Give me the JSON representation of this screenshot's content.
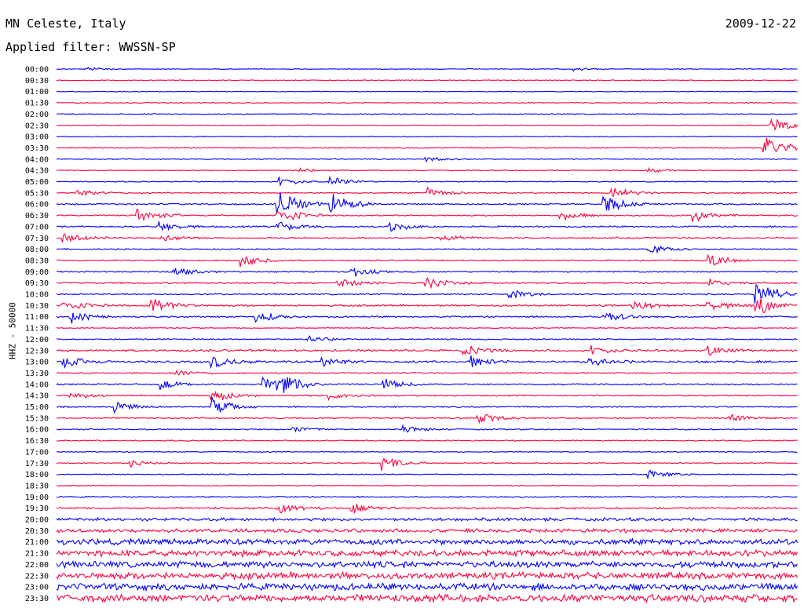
{
  "header": {
    "station": "MN Celeste, Italy",
    "date": "2009-12-22",
    "filter": "Applied filter: WWSSN-SP"
  },
  "chart_data": {
    "type": "line",
    "title": "MN Celeste, Italy",
    "date": "2009-12-22",
    "filter": "Applied filter: WWSSN-SP",
    "ylabel": "HHZ - 50000",
    "series_colors": [
      "#0000ff",
      "#ff0040"
    ],
    "rows": [
      {
        "label": "00:00",
        "amp": 0.12,
        "events": [
          {
            "x": 0.04,
            "h": 0.3
          },
          {
            "x": 0.7,
            "h": 0.3
          }
        ]
      },
      {
        "label": "00:30",
        "amp": 0.15,
        "events": []
      },
      {
        "label": "01:00",
        "amp": 0.12,
        "events": []
      },
      {
        "label": "01:30",
        "amp": 0.15,
        "events": []
      },
      {
        "label": "02:00",
        "amp": 0.15,
        "events": []
      },
      {
        "label": "02:30",
        "amp": 0.15,
        "events": [
          {
            "x": 0.965,
            "h": 1.5
          }
        ]
      },
      {
        "label": "03:00",
        "amp": 0.15,
        "events": []
      },
      {
        "label": "03:30",
        "amp": 0.18,
        "events": [
          {
            "x": 0.955,
            "h": 2.5
          }
        ]
      },
      {
        "label": "04:00",
        "amp": 0.15,
        "events": [
          {
            "x": 0.5,
            "h": 0.4
          }
        ]
      },
      {
        "label": "04:30",
        "amp": 0.15,
        "events": [
          {
            "x": 0.33,
            "h": 0.4
          },
          {
            "x": 0.8,
            "h": 0.3
          }
        ]
      },
      {
        "label": "05:00",
        "amp": 0.15,
        "events": [
          {
            "x": 0.3,
            "h": 0.8
          },
          {
            "x": 0.37,
            "h": 0.8
          }
        ]
      },
      {
        "label": "05:30",
        "amp": 0.2,
        "events": [
          {
            "x": 0.03,
            "h": 0.6
          },
          {
            "x": 0.5,
            "h": 0.8
          },
          {
            "x": 0.75,
            "h": 1.0
          }
        ]
      },
      {
        "label": "06:00",
        "amp": 0.25,
        "events": [
          {
            "x": 0.3,
            "h": 2.5
          },
          {
            "x": 0.37,
            "h": 2.0
          },
          {
            "x": 0.74,
            "h": 1.5
          }
        ]
      },
      {
        "label": "06:30",
        "amp": 0.22,
        "events": [
          {
            "x": 0.11,
            "h": 1.2
          },
          {
            "x": 0.3,
            "h": 1.5
          },
          {
            "x": 0.68,
            "h": 0.8
          },
          {
            "x": 0.86,
            "h": 1.0
          }
        ]
      },
      {
        "label": "07:00",
        "amp": 0.25,
        "events": [
          {
            "x": 0.14,
            "h": 0.8
          },
          {
            "x": 0.3,
            "h": 1.0
          },
          {
            "x": 0.45,
            "h": 0.8
          }
        ]
      },
      {
        "label": "07:30",
        "amp": 0.25,
        "events": [
          {
            "x": 0.01,
            "h": 1.0
          },
          {
            "x": 0.14,
            "h": 0.6
          },
          {
            "x": 0.52,
            "h": 0.6
          }
        ]
      },
      {
        "label": "08:00",
        "amp": 0.2,
        "events": [
          {
            "x": 0.8,
            "h": 0.8
          }
        ]
      },
      {
        "label": "08:30",
        "amp": 0.22,
        "events": [
          {
            "x": 0.25,
            "h": 1.0
          },
          {
            "x": 0.88,
            "h": 1.2
          }
        ]
      },
      {
        "label": "09:00",
        "amp": 0.22,
        "events": [
          {
            "x": 0.16,
            "h": 0.8
          },
          {
            "x": 0.4,
            "h": 0.8
          }
        ]
      },
      {
        "label": "09:30",
        "amp": 0.25,
        "events": [
          {
            "x": 0.38,
            "h": 0.8
          },
          {
            "x": 0.5,
            "h": 1.0
          },
          {
            "x": 0.88,
            "h": 0.6
          }
        ]
      },
      {
        "label": "10:00",
        "amp": 0.22,
        "events": [
          {
            "x": 0.61,
            "h": 0.8
          },
          {
            "x": 0.945,
            "h": 2.5
          }
        ]
      },
      {
        "label": "10:30",
        "amp": 0.3,
        "events": [
          {
            "x": 0.01,
            "h": 1.0
          },
          {
            "x": 0.13,
            "h": 1.5
          },
          {
            "x": 0.78,
            "h": 0.8
          },
          {
            "x": 0.88,
            "h": 0.8
          },
          {
            "x": 0.945,
            "h": 1.5
          }
        ]
      },
      {
        "label": "11:00",
        "amp": 0.25,
        "events": [
          {
            "x": 0.02,
            "h": 1.0
          },
          {
            "x": 0.27,
            "h": 1.0
          },
          {
            "x": 0.74,
            "h": 1.0
          }
        ]
      },
      {
        "label": "11:30",
        "amp": 0.15,
        "events": []
      },
      {
        "label": "12:00",
        "amp": 0.2,
        "events": [
          {
            "x": 0.34,
            "h": 0.6
          }
        ]
      },
      {
        "label": "12:30",
        "amp": 0.35,
        "events": [
          {
            "x": 0.55,
            "h": 0.8
          },
          {
            "x": 0.72,
            "h": 0.8
          },
          {
            "x": 0.88,
            "h": 0.8
          }
        ]
      },
      {
        "label": "13:00",
        "amp": 0.35,
        "events": [
          {
            "x": 0.01,
            "h": 1.0
          },
          {
            "x": 0.21,
            "h": 1.0
          },
          {
            "x": 0.36,
            "h": 0.8
          },
          {
            "x": 0.56,
            "h": 1.0
          },
          {
            "x": 0.72,
            "h": 0.8
          }
        ]
      },
      {
        "label": "13:30",
        "amp": 0.22,
        "events": [
          {
            "x": 0.16,
            "h": 0.6
          }
        ]
      },
      {
        "label": "14:00",
        "amp": 0.25,
        "events": [
          {
            "x": 0.14,
            "h": 0.8
          },
          {
            "x": 0.28,
            "h": 1.0
          },
          {
            "x": 0.3,
            "h": 1.8
          },
          {
            "x": 0.44,
            "h": 1.0
          }
        ]
      },
      {
        "label": "14:30",
        "amp": 0.22,
        "events": [
          {
            "x": 0.02,
            "h": 0.6
          },
          {
            "x": 0.21,
            "h": 1.2
          },
          {
            "x": 0.37,
            "h": 0.6
          }
        ]
      },
      {
        "label": "15:00",
        "amp": 0.22,
        "events": [
          {
            "x": 0.08,
            "h": 0.8
          },
          {
            "x": 0.21,
            "h": 1.5
          }
        ]
      },
      {
        "label": "15:30",
        "amp": 0.22,
        "events": [
          {
            "x": 0.57,
            "h": 1.0
          },
          {
            "x": 0.91,
            "h": 0.6
          }
        ]
      },
      {
        "label": "16:00",
        "amp": 0.2,
        "events": [
          {
            "x": 0.32,
            "h": 0.5
          },
          {
            "x": 0.47,
            "h": 0.5
          }
        ]
      },
      {
        "label": "16:30",
        "amp": 0.18,
        "events": []
      },
      {
        "label": "17:00",
        "amp": 0.15,
        "events": []
      },
      {
        "label": "17:30",
        "amp": 0.18,
        "events": [
          {
            "x": 0.1,
            "h": 0.5
          },
          {
            "x": 0.44,
            "h": 1.2
          }
        ]
      },
      {
        "label": "18:00",
        "amp": 0.18,
        "events": [
          {
            "x": 0.8,
            "h": 0.8
          }
        ]
      },
      {
        "label": "18:30",
        "amp": 0.15,
        "events": []
      },
      {
        "label": "19:00",
        "amp": 0.2,
        "events": []
      },
      {
        "label": "19:30",
        "amp": 0.3,
        "events": [
          {
            "x": 0.3,
            "h": 0.8
          },
          {
            "x": 0.4,
            "h": 0.8
          }
        ]
      },
      {
        "label": "20:00",
        "amp": 0.5,
        "events": []
      },
      {
        "label": "20:30",
        "amp": 0.6,
        "events": []
      },
      {
        "label": "21:00",
        "amp": 0.9,
        "events": []
      },
      {
        "label": "21:30",
        "amp": 1.0,
        "events": []
      },
      {
        "label": "22:00",
        "amp": 1.0,
        "events": []
      },
      {
        "label": "22:30",
        "amp": 1.05,
        "events": []
      },
      {
        "label": "23:00",
        "amp": 1.1,
        "events": []
      },
      {
        "label": "23:30",
        "amp": 1.2,
        "events": []
      }
    ]
  }
}
